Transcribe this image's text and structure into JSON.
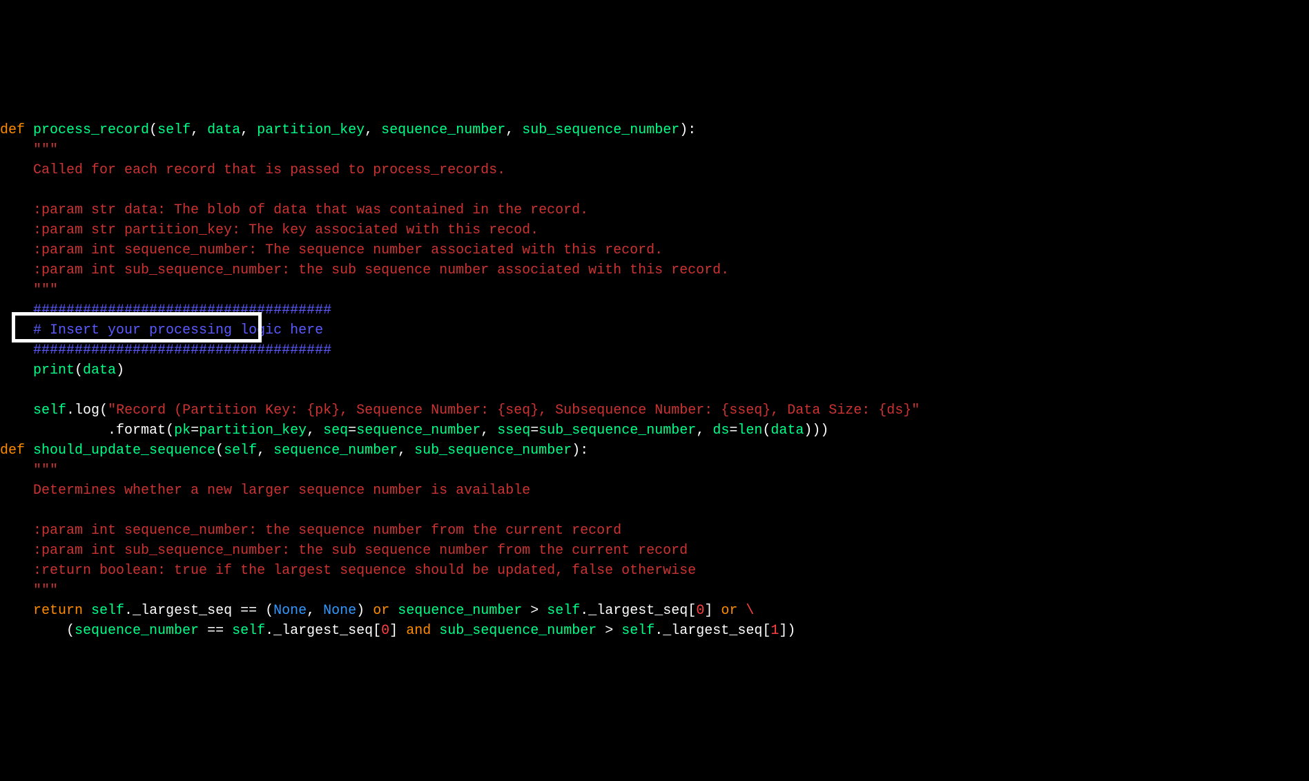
{
  "code": {
    "lines": [
      {
        "indent": 0,
        "parts": [
          {
            "t": "def ",
            "c": "kw"
          },
          {
            "t": "process_record",
            "c": "fn"
          },
          {
            "t": "(",
            "c": "op"
          },
          {
            "t": "self",
            "c": "param"
          },
          {
            "t": ", ",
            "c": "op"
          },
          {
            "t": "data",
            "c": "param"
          },
          {
            "t": ", ",
            "c": "op"
          },
          {
            "t": "partition_key",
            "c": "param"
          },
          {
            "t": ", ",
            "c": "op"
          },
          {
            "t": "sequence_number",
            "c": "param"
          },
          {
            "t": ", ",
            "c": "op"
          },
          {
            "t": "sub_sequence_number",
            "c": "param"
          },
          {
            "t": ")",
            "c": "op"
          },
          {
            "t": ":",
            "c": "op"
          }
        ]
      },
      {
        "indent": 1,
        "parts": [
          {
            "t": "\"\"\"",
            "c": "str"
          }
        ]
      },
      {
        "indent": 1,
        "parts": [
          {
            "t": "Called for each record that is passed to process_records.",
            "c": "str"
          }
        ]
      },
      {
        "indent": 1,
        "parts": [
          {
            "t": "",
            "c": "str"
          }
        ]
      },
      {
        "indent": 1,
        "parts": [
          {
            "t": ":param str data: The blob of data that was contained in the record.",
            "c": "str"
          }
        ]
      },
      {
        "indent": 1,
        "parts": [
          {
            "t": ":param str partition_key: The key associated with this recod.",
            "c": "str"
          }
        ]
      },
      {
        "indent": 1,
        "parts": [
          {
            "t": ":param int sequence_number: The sequence number associated with this record.",
            "c": "str"
          }
        ]
      },
      {
        "indent": 1,
        "parts": [
          {
            "t": ":param int sub_sequence_number: the sub sequence number associated with this record.",
            "c": "str"
          }
        ]
      },
      {
        "indent": 1,
        "parts": [
          {
            "t": "\"\"\"",
            "c": "str"
          }
        ]
      },
      {
        "indent": 1,
        "parts": [
          {
            "t": "####################################",
            "c": "cmt"
          }
        ]
      },
      {
        "indent": 1,
        "parts": [
          {
            "t": "# Insert your processing logic here",
            "c": "cmt"
          }
        ]
      },
      {
        "indent": 1,
        "parts": [
          {
            "t": "####################################",
            "c": "cmt"
          }
        ]
      },
      {
        "indent": 1,
        "parts": [
          {
            "t": "print",
            "c": "fn"
          },
          {
            "t": "(",
            "c": "op"
          },
          {
            "t": "data",
            "c": "param"
          },
          {
            "t": ")",
            "c": "op"
          }
        ]
      },
      {
        "indent": 1,
        "parts": [
          {
            "t": "",
            "c": "op"
          }
        ]
      },
      {
        "indent": 1,
        "parts": [
          {
            "t": "self",
            "c": "param"
          },
          {
            "t": ".",
            "c": "op"
          },
          {
            "t": "log",
            "c": "op"
          },
          {
            "t": "(",
            "c": "op"
          },
          {
            "t": "\"Record (Partition Key: {pk}, Sequence Number: {seq}, Subsequence Number: {sseq}, Data Size: {ds}\"",
            "c": "str"
          }
        ]
      },
      {
        "indent": 3,
        "parts": [
          {
            "t": " .",
            "c": "op"
          },
          {
            "t": "format",
            "c": "op"
          },
          {
            "t": "(",
            "c": "op"
          },
          {
            "t": "pk",
            "c": "param"
          },
          {
            "t": "=",
            "c": "op"
          },
          {
            "t": "partition_key",
            "c": "param"
          },
          {
            "t": ", ",
            "c": "op"
          },
          {
            "t": "seq",
            "c": "param"
          },
          {
            "t": "=",
            "c": "op"
          },
          {
            "t": "sequence_number",
            "c": "param"
          },
          {
            "t": ", ",
            "c": "op"
          },
          {
            "t": "sseq",
            "c": "param"
          },
          {
            "t": "=",
            "c": "op"
          },
          {
            "t": "sub_sequence_number",
            "c": "param"
          },
          {
            "t": ", ",
            "c": "op"
          },
          {
            "t": "ds",
            "c": "param"
          },
          {
            "t": "=",
            "c": "op"
          },
          {
            "t": "len",
            "c": "fn"
          },
          {
            "t": "(",
            "c": "op"
          },
          {
            "t": "data",
            "c": "param"
          },
          {
            "t": ")))",
            "c": "op"
          }
        ]
      },
      {
        "indent": 0,
        "parts": [
          {
            "t": "",
            "c": "op"
          }
        ]
      },
      {
        "indent": 0,
        "parts": [
          {
            "t": "def ",
            "c": "kw"
          },
          {
            "t": "should_update_sequence",
            "c": "fn"
          },
          {
            "t": "(",
            "c": "op"
          },
          {
            "t": "self",
            "c": "param"
          },
          {
            "t": ", ",
            "c": "op"
          },
          {
            "t": "sequence_number",
            "c": "param"
          },
          {
            "t": ", ",
            "c": "op"
          },
          {
            "t": "sub_sequence_number",
            "c": "param"
          },
          {
            "t": ")",
            "c": "op"
          },
          {
            "t": ":",
            "c": "op"
          }
        ]
      },
      {
        "indent": 1,
        "parts": [
          {
            "t": "\"\"\"",
            "c": "str"
          }
        ]
      },
      {
        "indent": 1,
        "parts": [
          {
            "t": "Determines whether a new larger sequence number is available",
            "c": "str"
          }
        ]
      },
      {
        "indent": 1,
        "parts": [
          {
            "t": "",
            "c": "str"
          }
        ]
      },
      {
        "indent": 1,
        "parts": [
          {
            "t": ":param int sequence_number: the sequence number from the current record",
            "c": "str"
          }
        ]
      },
      {
        "indent": 1,
        "parts": [
          {
            "t": ":param int sub_sequence_number: the sub sequence number from the current record",
            "c": "str"
          }
        ]
      },
      {
        "indent": 1,
        "parts": [
          {
            "t": ":return boolean: true if the largest sequence should be updated, false otherwise",
            "c": "str"
          }
        ]
      },
      {
        "indent": 1,
        "parts": [
          {
            "t": "\"\"\"",
            "c": "str"
          }
        ]
      },
      {
        "indent": 1,
        "parts": [
          {
            "t": "return ",
            "c": "kw"
          },
          {
            "t": "self",
            "c": "param"
          },
          {
            "t": ".",
            "c": "op"
          },
          {
            "t": "_largest_seq ",
            "c": "op"
          },
          {
            "t": "==",
            "c": "op"
          },
          {
            "t": " (",
            "c": "op"
          },
          {
            "t": "None",
            "c": "kw2"
          },
          {
            "t": ", ",
            "c": "op"
          },
          {
            "t": "None",
            "c": "kw2"
          },
          {
            "t": ") ",
            "c": "op"
          },
          {
            "t": "or ",
            "c": "kw"
          },
          {
            "t": "sequence_number ",
            "c": "param"
          },
          {
            "t": "> ",
            "c": "op"
          },
          {
            "t": "self",
            "c": "param"
          },
          {
            "t": ".",
            "c": "op"
          },
          {
            "t": "_largest_seq[",
            "c": "op"
          },
          {
            "t": "0",
            "c": "num"
          },
          {
            "t": "] ",
            "c": "op"
          },
          {
            "t": "or ",
            "c": "kw"
          },
          {
            "t": "\\",
            "c": "num"
          }
        ]
      },
      {
        "indent": 2,
        "parts": [
          {
            "t": "(",
            "c": "op"
          },
          {
            "t": "sequence_number ",
            "c": "param"
          },
          {
            "t": "==",
            "c": "op"
          },
          {
            "t": " ",
            "c": "op"
          },
          {
            "t": "self",
            "c": "param"
          },
          {
            "t": ".",
            "c": "op"
          },
          {
            "t": "_largest_seq[",
            "c": "op"
          },
          {
            "t": "0",
            "c": "num"
          },
          {
            "t": "] ",
            "c": "op"
          },
          {
            "t": "and ",
            "c": "kw"
          },
          {
            "t": "sub_sequence_number ",
            "c": "param"
          },
          {
            "t": "> ",
            "c": "op"
          },
          {
            "t": "self",
            "c": "param"
          },
          {
            "t": ".",
            "c": "op"
          },
          {
            "t": "_largest_seq[",
            "c": "op"
          },
          {
            "t": "1",
            "c": "num"
          },
          {
            "t": "])",
            "c": "op"
          }
        ]
      }
    ],
    "indent_unit": "    "
  }
}
